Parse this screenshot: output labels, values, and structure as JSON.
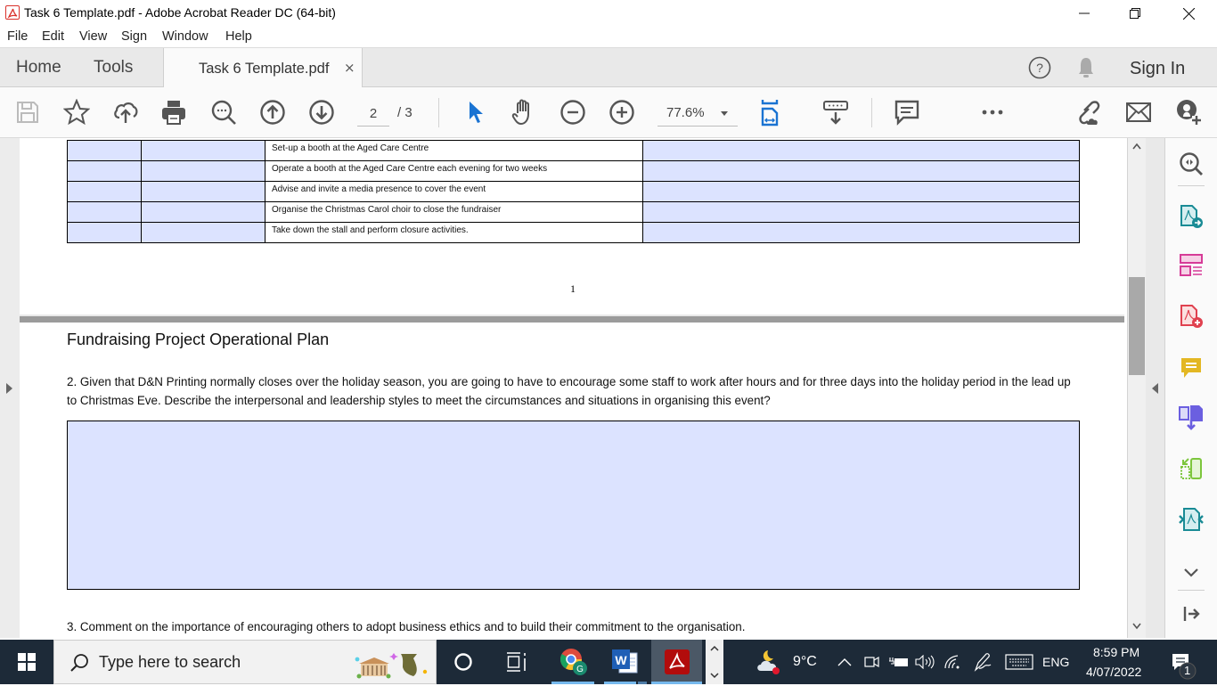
{
  "window": {
    "title": "Task 6 Template.pdf - Adobe Acrobat Reader DC (64-bit)",
    "controls": [
      "minimize",
      "restore",
      "close"
    ]
  },
  "menu": [
    "File",
    "Edit",
    "View",
    "Sign",
    "Window",
    "Help"
  ],
  "tabs": {
    "home": "Home",
    "tools": "Tools",
    "document": "Task 6 Template.pdf",
    "close_symbol": "×",
    "sign_in": "Sign In"
  },
  "toolbar": {
    "icons": [
      "save-icon",
      "bookmark-star-icon",
      "upload-cloud-icon",
      "print-icon",
      "find-icon",
      "page-up-icon",
      "page-down-icon",
      "select-arrow-icon",
      "hand-icon",
      "zoom-out-icon",
      "zoom-in-icon",
      "fit-page-icon",
      "keyboard-scroll-icon",
      "comment-icon",
      "more-icon",
      "share-link-icon",
      "email-icon",
      "add-user-icon"
    ],
    "page_current": "2",
    "page_total": "/ 3",
    "zoom": "77.6%"
  },
  "document": {
    "page1": {
      "table_rows": [
        "Set-up a booth at the Aged Care Centre",
        "Operate a booth at the Aged Care Centre each evening for two weeks",
        "Advise and invite a media presence to cover the event",
        "Organise the Christmas Carol choir to close the fundraiser",
        "Take down the stall and perform closure activities."
      ],
      "page_number": "1"
    },
    "page2": {
      "heading": "Fundraising Project Operational Plan",
      "question2": "2. Given that D&N Printing normally closes over the holiday season, you are going to have to encourage some staff to work after hours and for three days into the holiday period in the lead up to Christmas Eve.  Describe the interpersonal and leadership styles to meet the circumstances and situations in organising this event?",
      "answer2": "",
      "question3": "3. Comment on the importance of encouraging others to adopt business ethics and to build their commitment to the organisation."
    },
    "field_fill_color": "#dce3ff"
  },
  "right_pane": {
    "tools": [
      "zoom-tool-icon",
      "export-pdf-icon",
      "create-form-icon",
      "create-pdf-icon",
      "comment-tool-icon",
      "combine-files-icon",
      "organize-pages-icon",
      "compress-pdf-icon",
      "more-tools-chevron-icon",
      "collapse-pane-icon"
    ]
  },
  "taskbar": {
    "search_placeholder": "Type here to search",
    "weather": "9°C",
    "language": "ENG",
    "time": "8:59 PM",
    "date": "4/07/2022",
    "notification_count": "1"
  }
}
